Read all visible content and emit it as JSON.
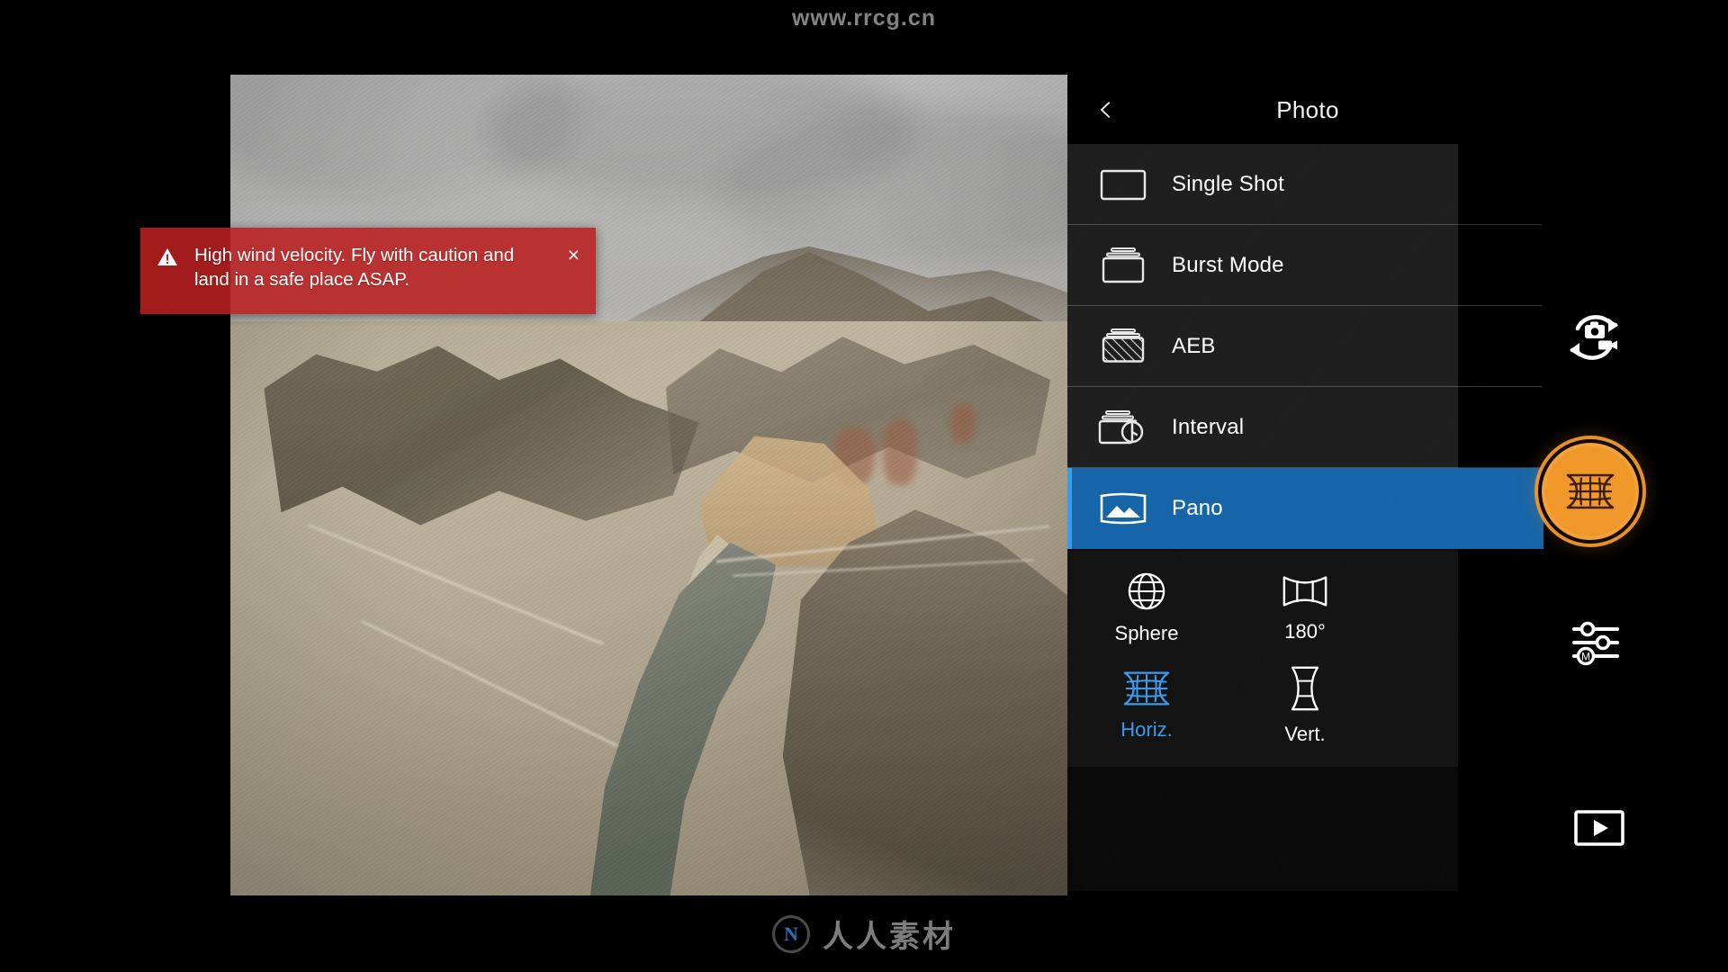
{
  "watermarks": {
    "top": "www.rrcg.cn",
    "bottom_logo": "N",
    "bottom_text": "人人素材"
  },
  "alert": {
    "icon": "warning-triangle-icon",
    "message": "High wind velocity. Fly with caution and land in a safe place ASAP.",
    "close_label": "×",
    "color": "#b92020"
  },
  "panel": {
    "back_icon": "chevron-left-icon",
    "title": "Photo",
    "accent_color": "#1565a8",
    "selected_mode": "Pano",
    "modes": [
      {
        "label": "Single Shot",
        "icon": "single-frame-icon",
        "selected": false
      },
      {
        "label": "Burst Mode",
        "icon": "stacked-frames-icon",
        "selected": false
      },
      {
        "label": "AEB",
        "icon": "hatched-frame-icon",
        "selected": false
      },
      {
        "label": "Interval",
        "icon": "frame-timer-icon",
        "selected": false
      },
      {
        "label": "Pano",
        "icon": "panorama-icon",
        "selected": true
      }
    ],
    "pano_options": [
      {
        "label": "Sphere",
        "icon": "sphere-globe-icon",
        "active": false
      },
      {
        "label": "180°",
        "icon": "wide-180-icon",
        "active": false
      },
      {
        "label": "Horiz.",
        "icon": "horizontal-grid-icon",
        "active": true
      },
      {
        "label": "Vert.",
        "icon": "vertical-grid-icon",
        "active": false
      }
    ],
    "active_pano_option": "Horiz.",
    "active_pano_color": "#3b9bea"
  },
  "rail": {
    "swap_label": "camera-video-swap-icon",
    "shutter_label": "pano-grid-shutter-icon",
    "shutter_color": "#f0982a",
    "settings_label": "manual-settings-icon",
    "playback_label": "playback-icon"
  }
}
